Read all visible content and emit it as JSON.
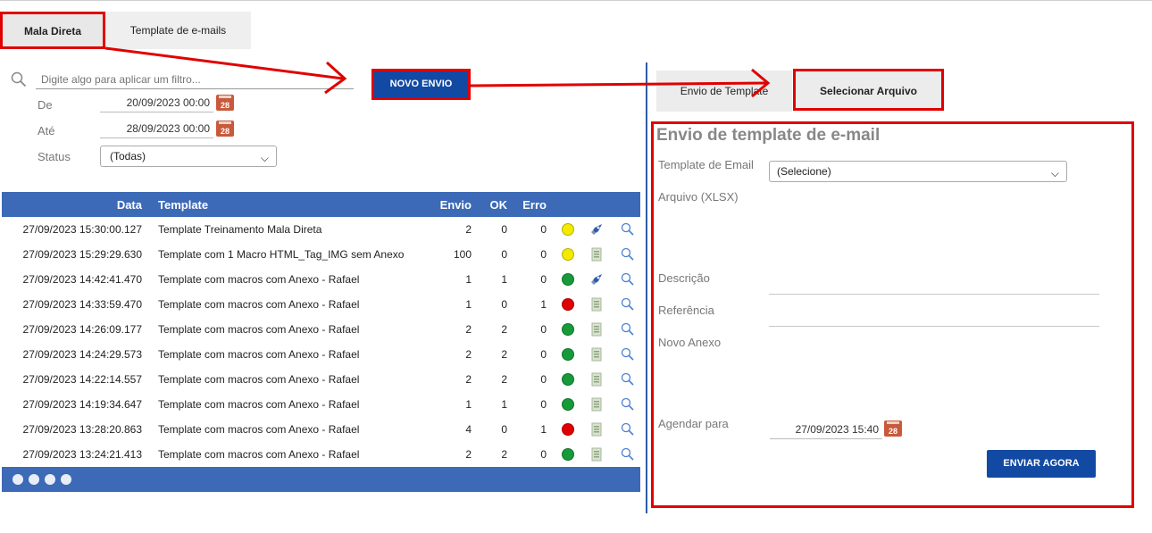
{
  "tabs": {
    "mala": "Mala Direta",
    "template": "Template de e-mails"
  },
  "filter": {
    "placeholder": "Digite algo para aplicar um filtro...",
    "de_label": "De",
    "de_value": "20/09/2023 00:00",
    "ate_label": "Até",
    "ate_value": "28/09/2023 00:00",
    "status_label": "Status",
    "status_value": "(Todas)",
    "calendar_day": "28"
  },
  "novo_envio": "NOVO ENVIO",
  "grid": {
    "headers": {
      "data": "Data",
      "template": "Template",
      "envio": "Envio",
      "ok": "OK",
      "erro": "Erro"
    },
    "rows": [
      {
        "data": "27/09/2023 15:30:00.127",
        "template": "Template Treinamento Mala Direta",
        "envio": "2",
        "ok": "0",
        "erro": "0",
        "status": "yellow",
        "action": "rocket-icon"
      },
      {
        "data": "27/09/2023 15:29:29.630",
        "template": "Template com 1 Macro HTML_Tag_IMG sem Anexo",
        "envio": "100",
        "ok": "0",
        "erro": "0",
        "status": "yellow",
        "action": "spreadsheet-icon"
      },
      {
        "data": "27/09/2023 14:42:41.470",
        "template": "Template com macros com Anexo - Rafael",
        "envio": "1",
        "ok": "1",
        "erro": "0",
        "status": "green",
        "action": "rocket-icon"
      },
      {
        "data": "27/09/2023 14:33:59.470",
        "template": "Template com macros com Anexo - Rafael",
        "envio": "1",
        "ok": "0",
        "erro": "1",
        "status": "red",
        "action": "spreadsheet-icon"
      },
      {
        "data": "27/09/2023 14:26:09.177",
        "template": "Template com macros com Anexo - Rafael",
        "envio": "2",
        "ok": "2",
        "erro": "0",
        "status": "green",
        "action": "spreadsheet-icon"
      },
      {
        "data": "27/09/2023 14:24:29.573",
        "template": "Template com macros com Anexo - Rafael",
        "envio": "2",
        "ok": "2",
        "erro": "0",
        "status": "green",
        "action": "spreadsheet-icon"
      },
      {
        "data": "27/09/2023 14:22:14.557",
        "template": "Template com macros com Anexo - Rafael",
        "envio": "2",
        "ok": "2",
        "erro": "0",
        "status": "green",
        "action": "spreadsheet-icon"
      },
      {
        "data": "27/09/2023 14:19:34.647",
        "template": "Template com macros com Anexo - Rafael",
        "envio": "1",
        "ok": "1",
        "erro": "0",
        "status": "green",
        "action": "spreadsheet-icon"
      },
      {
        "data": "27/09/2023 13:28:20.863",
        "template": "Template com macros com Anexo - Rafael",
        "envio": "4",
        "ok": "0",
        "erro": "1",
        "status": "red",
        "action": "spreadsheet-icon"
      },
      {
        "data": "27/09/2023 13:24:21.413",
        "template": "Template com macros com Anexo - Rafael",
        "envio": "2",
        "ok": "2",
        "erro": "0",
        "status": "green",
        "action": "spreadsheet-icon"
      }
    ]
  },
  "right_tabs": {
    "envio": "Envio de Template",
    "selecionar": "Selecionar Arquivo"
  },
  "form": {
    "title": "Envio de template de e-mail",
    "template_label": "Template de Email",
    "template_value": "(Selecione)",
    "arquivo_label": "Arquivo (XLSX)",
    "descricao_label": "Descrição",
    "referencia_label": "Referência",
    "novo_anexo_label": "Novo Anexo",
    "agendar_label": "Agendar para",
    "agendar_value": "27/09/2023 15:40",
    "submit": "ENVIAR AGORA"
  },
  "colors": {
    "accent_blue": "#124aa3",
    "grid_blue": "#3d6ab7",
    "highlight_red": "#e00000",
    "yellow": "#f4ea00",
    "green": "#169a3a",
    "red": "#e00000"
  }
}
